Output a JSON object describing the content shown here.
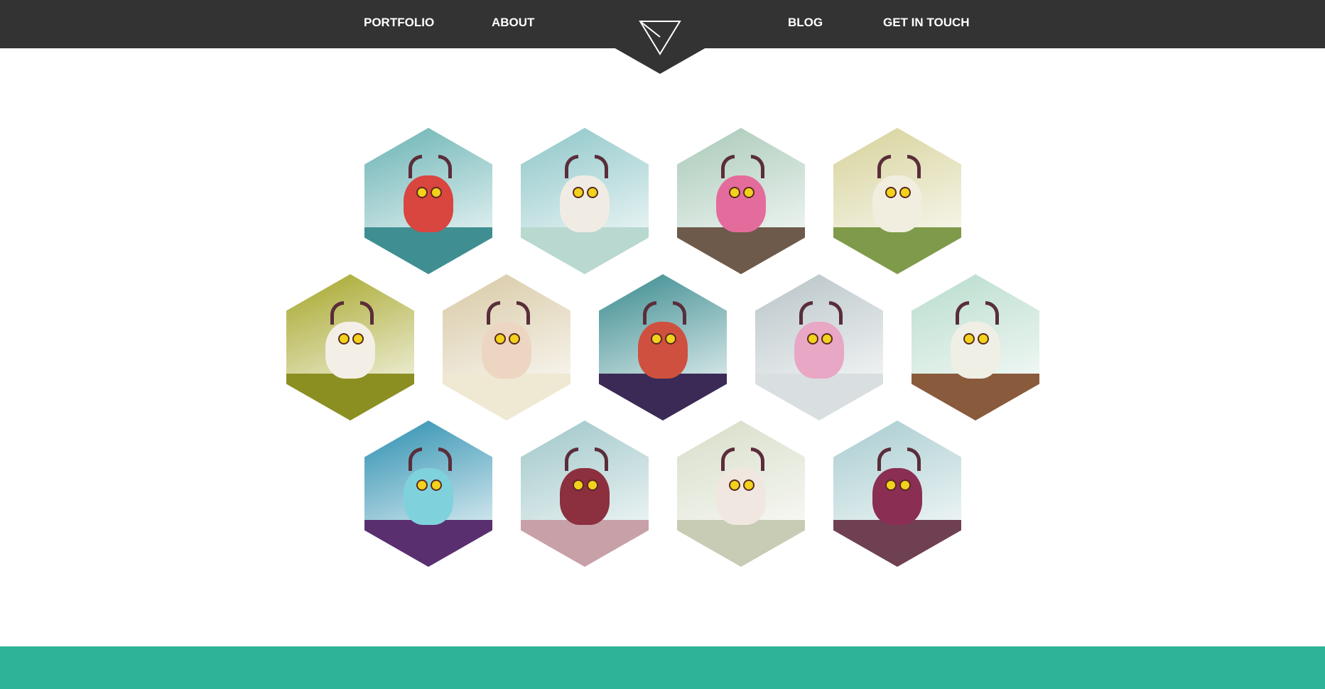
{
  "nav": {
    "portfolio": "PORTFOLIO",
    "about": "ABOUT",
    "blog": "BLOG",
    "contact": "GET IN TOUCH"
  },
  "colors": {
    "header": "#333333",
    "footer": "#2eb398",
    "background": "#ffffff"
  },
  "gallery": [
    {
      "name": "red-horned-monster",
      "sky": "#6ab3b4",
      "ground": "#3f8f92",
      "body": "#d9453f"
    },
    {
      "name": "flying-sheep-monster",
      "sky": "#8ec6c8",
      "ground": "#b9d8cf",
      "body": "#f0ece4"
    },
    {
      "name": "pink-multi-eyed-monster",
      "sky": "#a9c9b8",
      "ground": "#6e5a4a",
      "body": "#e46c9c"
    },
    {
      "name": "puppet-cow-monster",
      "sky": "#d6d29a",
      "ground": "#7f9a4a",
      "body": "#f1eee0"
    },
    {
      "name": "lying-unicorn-pig",
      "sky": "#a6a62a",
      "ground": "#8b8f22",
      "body": "#f3efe6"
    },
    {
      "name": "antlered-pig",
      "sky": "#d8c9a5",
      "ground": "#efe8d2",
      "body": "#ecd6c1"
    },
    {
      "name": "octopus-monster",
      "sky": "#3a8b8f",
      "ground": "#3a2a55",
      "body": "#d0503f"
    },
    {
      "name": "two-horned-yetis",
      "sky": "#b8c4c8",
      "ground": "#d9dfe0",
      "body": "#e8a7c5"
    },
    {
      "name": "white-yeti-on-branch",
      "sky": "#b8dccc",
      "ground": "#8a5a3d",
      "body": "#f0efe6"
    },
    {
      "name": "jellyfish-creature",
      "sky": "#2c8fb0",
      "ground": "#5a2f70",
      "body": "#7fd2dc"
    },
    {
      "name": "tiki-mask-monster",
      "sky": "#9fc6c8",
      "ground": "#c8a0a8",
      "body": "#8c2f3f"
    },
    {
      "name": "winged-creature",
      "sky": "#d7ddc8",
      "ground": "#c9ccb4",
      "body": "#f0e8e0"
    },
    {
      "name": "purple-lake-monster",
      "sky": "#a8ccd0",
      "ground": "#6f3f52",
      "body": "#8a2e54"
    }
  ]
}
